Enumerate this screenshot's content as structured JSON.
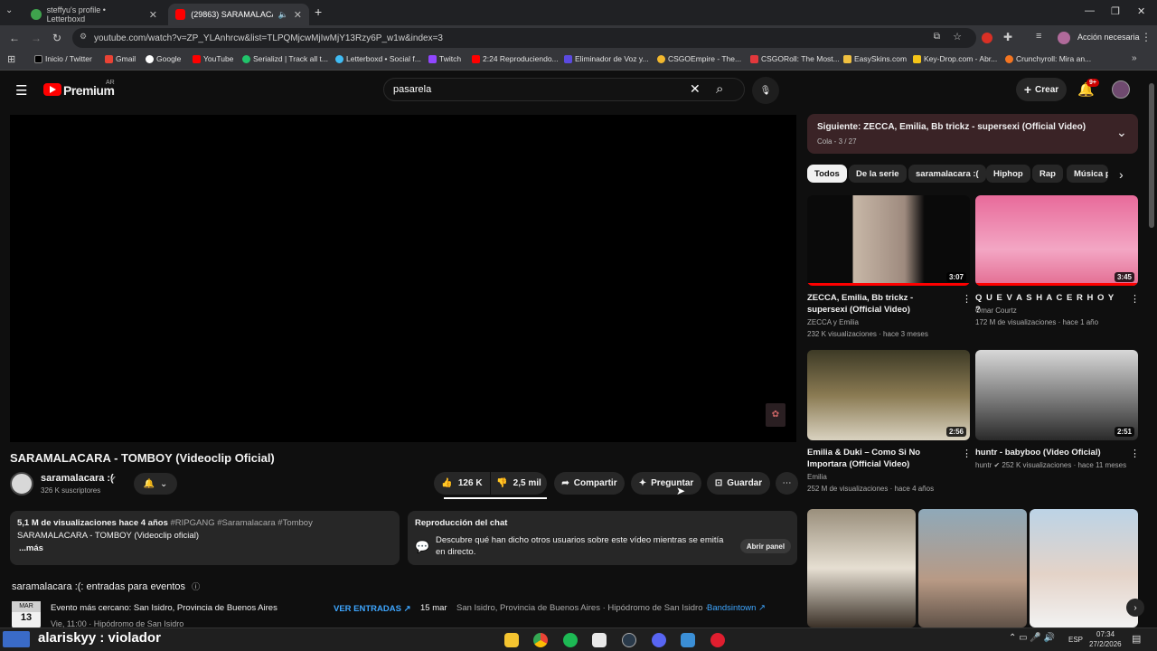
{
  "browser": {
    "tabs": [
      {
        "label": "steffyu's profile • Letterboxd"
      },
      {
        "label": "(29863) SARAMALACARA -"
      }
    ],
    "url": "youtube.com/watch?v=ZP_YLAnhrcw&list=TLPQMjcwMjIwMjY13Rzy6P_w1w&index=3",
    "action_button": "Acción necesaria",
    "bookmarks": [
      {
        "label": "Inicio / Twitter",
        "color": "#ffffff"
      },
      {
        "label": "Gmail",
        "color": "#ea4335"
      },
      {
        "label": "Google",
        "color": "#4285f4"
      },
      {
        "label": "YouTube",
        "color": "#ff0000"
      },
      {
        "label": "Serializd | Track all t...",
        "color": "#21c46b"
      },
      {
        "label": "Letterboxd • Social f...",
        "color": "#40bcf4"
      },
      {
        "label": "Twitch",
        "color": "#9146ff"
      },
      {
        "label": "2:24 Reproduciendo...",
        "color": "#ff0000"
      },
      {
        "label": "Eliminador de Voz y...",
        "color": "#5b4ae0"
      },
      {
        "label": "CSGOEmpire - The...",
        "color": "#f2b82e"
      },
      {
        "label": "CSGORoll: The Most...",
        "color": "#e2383c"
      },
      {
        "label": "EasySkins.com",
        "color": "#f0c040"
      },
      {
        "label": "Key-Drop.com - Abr...",
        "color": "#f5c518"
      },
      {
        "label": "Crunchyroll: Mira an...",
        "color": "#f47521"
      }
    ]
  },
  "header": {
    "logo": "Premium",
    "region": "AR",
    "search_value": "pasarela",
    "create_label": "Crear",
    "notif_badge": "9+"
  },
  "video": {
    "title": "SARAMALACARA - TOMBOY (Videoclip Oficial)",
    "channel": "saramalacara :(",
    "subscribers": "326 K suscriptores",
    "likes": "126 K",
    "dislikes": "2,5 mil",
    "share": "Compartir",
    "ask": "Preguntar",
    "save": "Guardar"
  },
  "description": {
    "stats": "5,1 M de visualizaciones  hace 4 años",
    "tags": "#RIPGANG #Saramalacara #Tomboy",
    "line": "SARAMALACARA - TOMBOY (Videoclip oficial)",
    "more": "...más"
  },
  "chat": {
    "title": "Reproducción del chat",
    "text": "Descubre qué han dicho otros usuarios sobre este vídeo mientras se emitía en directo.",
    "button": "Abrir panel"
  },
  "events": {
    "heading": "saramalacara :(: entradas para eventos",
    "month": "MAR",
    "day": "13",
    "title": "Evento más cercano: San Isidro, Provincia de Buenos Aires",
    "time": "Vie, 11:00 · Hipódromo de San Isidro",
    "tickets": "VER ENTRADAS",
    "date2": "15 mar",
    "place2": "San Isidro, Provincia de Buenos Aires · Hipódromo de San Isidro ·",
    "source": "Bandsintown"
  },
  "queue": {
    "next": "Siguiente: ZECCA, Emilia, Bb trickz - supersexi (Official Video)",
    "position": "Cola - 3 / 27"
  },
  "chips": [
    "Todos",
    "De la serie",
    "saramalacara :(",
    "Hiphop",
    "Rap",
    "Música p"
  ],
  "recommendations": [
    {
      "title": "ZECCA, Emilia, Bb trickz - supersexi (Official Video)",
      "channel": "ZECCA  y Emilia",
      "meta": "232 K visualizaciones · hace 3 meses",
      "duration": "3:07"
    },
    {
      "title": "Q U E V A S H A C E R H O Y ?",
      "channel": "Omar Courtz",
      "meta": "172 M de visualizaciones · hace 1 año",
      "duration": "3:45"
    },
    {
      "title": "Emilia & Duki – Como Si No Importara (Official Video)",
      "channel": "Emilia",
      "meta": "252 M de visualizaciones · hace 4 años",
      "duration": "2:56"
    },
    {
      "title": "huntr - babyboo (Video Oficial)",
      "channel": "huntr",
      "meta": "252 K visualizaciones · hace 11 meses",
      "duration": "2:51"
    }
  ],
  "overlay": {
    "text": "alariskyy : violador"
  },
  "system": {
    "lang": "ESP",
    "time": "07:34",
    "date": "27/2/2026"
  }
}
